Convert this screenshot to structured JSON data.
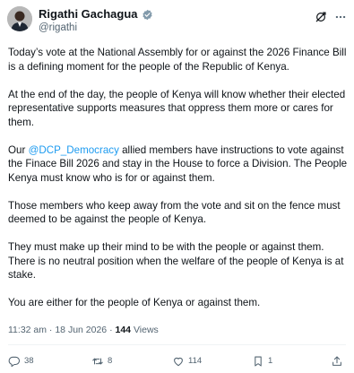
{
  "author": {
    "name": "Rigathi Gachagua",
    "handle": "@rigathi",
    "verified": true
  },
  "post": {
    "paragraphs": [
      {
        "text": "Today’s vote at the National Assembly for or against the 2026 Finance Bill is a defining moment for the people of the Republic of Kenya."
      },
      {
        "text": "At the end of the day, the people of Kenya will know whether their elected representative supports measures that oppress them more or cares for them."
      },
      {
        "before": "Our ",
        "mention": "@DCP_Democracy",
        "after": " allied members have instructions to vote against the Finace Bill 2026 and stay in the House to force a Division. The People Kenya must know who is for or against them."
      },
      {
        "text": "Those members who keep away from the vote and sit on the fence must deemed to be against the people of Kenya."
      },
      {
        "text": "They must make up their mind to be with the people or against them. There is no neutral position when the welfare of the people of Kenya is at stake."
      },
      {
        "text": "You are either for the people of Kenya or against them."
      }
    ]
  },
  "meta": {
    "time": "11:32 am",
    "separator": "·",
    "date": "18 Jun 2026",
    "views_count": "144",
    "views_label": "Views"
  },
  "actions": {
    "replies": "38",
    "reposts": "8",
    "likes": "114",
    "bookmarks": "1"
  },
  "colors": {
    "text": "#0f1419",
    "secondary": "#536471",
    "accent": "#1d9bf0",
    "divider": "#eff3f4"
  },
  "icons": [
    "verified-badge-icon",
    "grok-icon",
    "more-icon",
    "reply-icon",
    "repost-icon",
    "like-icon",
    "bookmark-icon",
    "share-icon"
  ]
}
